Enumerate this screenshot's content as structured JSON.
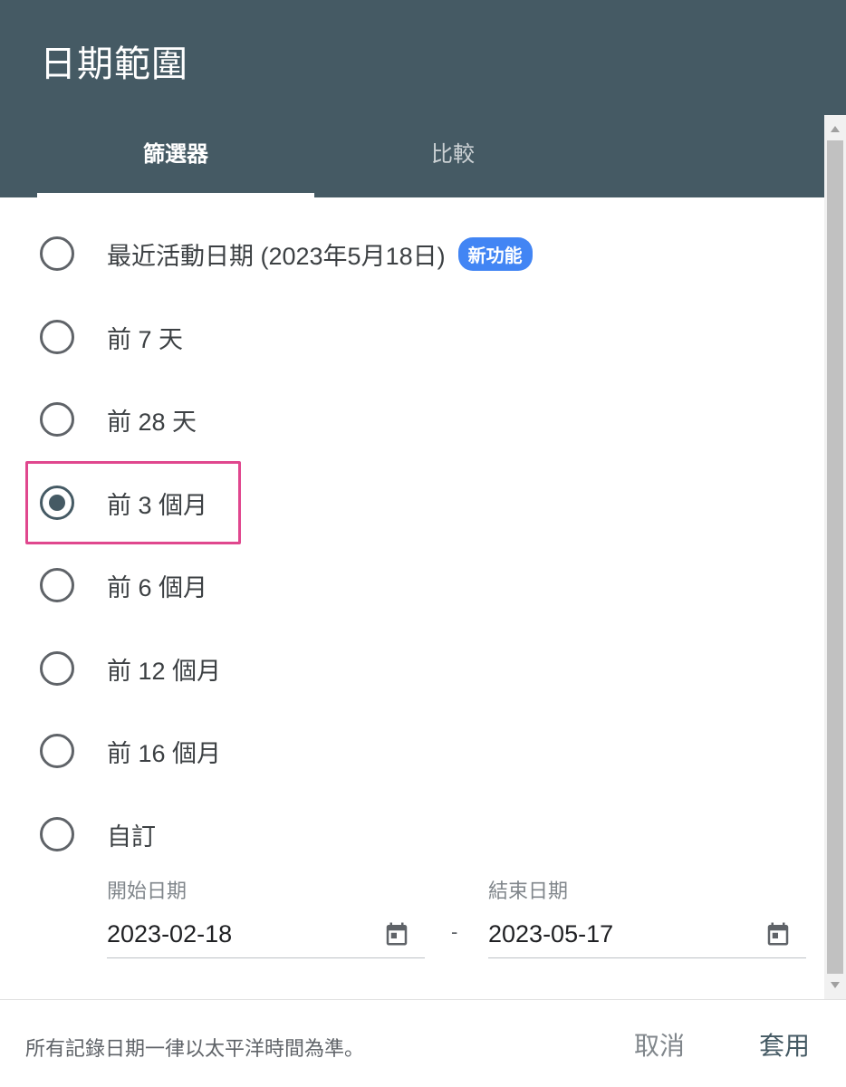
{
  "dialog": {
    "title": "日期範圍"
  },
  "tabs": [
    {
      "label": "篩選器",
      "active": true
    },
    {
      "label": "比較",
      "active": false
    }
  ],
  "options": [
    {
      "label": "最近活動日期 (2023年5月18日)",
      "badge": "新功能",
      "checked": false
    },
    {
      "label": "前 7 天",
      "checked": false
    },
    {
      "label": "前 28 天",
      "checked": false
    },
    {
      "label": "前 3 個月",
      "checked": true
    },
    {
      "label": "前 6 個月",
      "checked": false
    },
    {
      "label": "前 12 個月",
      "checked": false
    },
    {
      "label": "前 16 個月",
      "checked": false
    },
    {
      "label": "自訂",
      "checked": false
    }
  ],
  "custom_range": {
    "start_label": "開始日期",
    "start_value": "2023-02-18",
    "separator": "-",
    "end_label": "結束日期",
    "end_value": "2023-05-17",
    "icon": "calendar-icon"
  },
  "footer": {
    "note": "所有記錄日期一律以太平洋時間為準。",
    "cancel_label": "取消",
    "apply_label": "套用"
  },
  "colors": {
    "header": "#455a64",
    "badge": "#4285f4",
    "highlight": "#e0478e",
    "radio_checked": "#455a64"
  }
}
